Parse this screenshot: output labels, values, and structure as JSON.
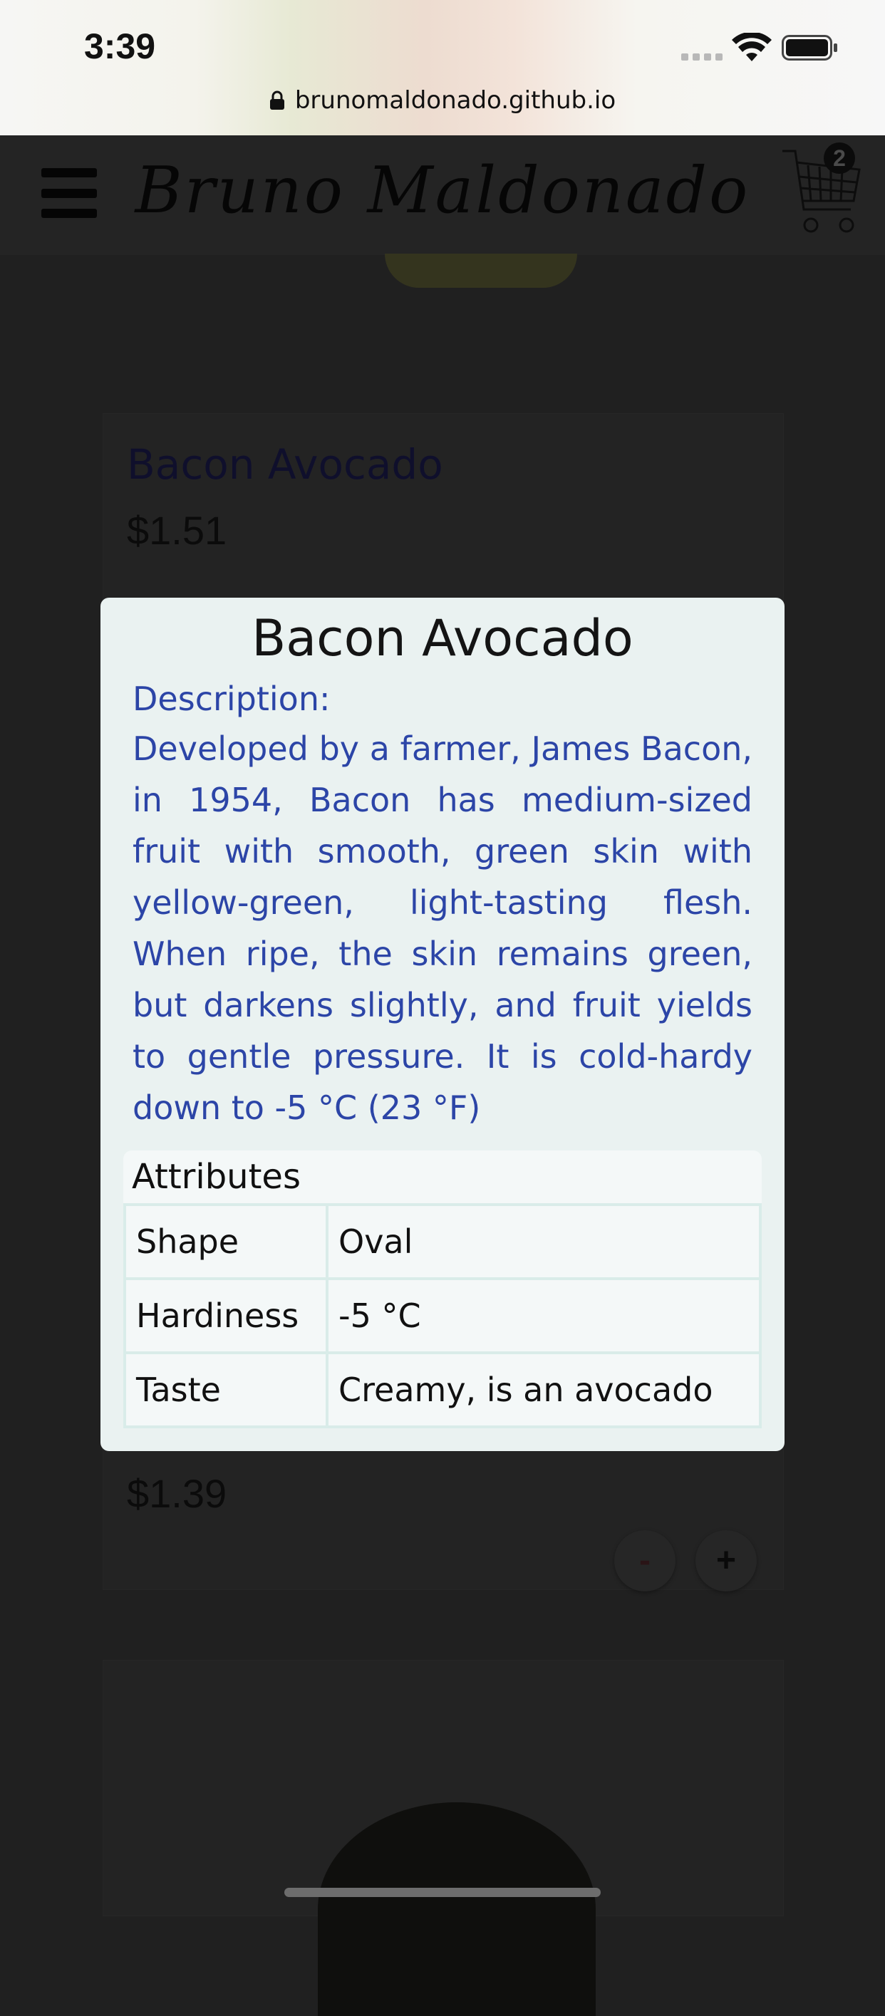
{
  "status_bar": {
    "time": "3:39",
    "url": "brunomaldonado.github.io"
  },
  "header": {
    "brand": "Bruno Maldonado",
    "cart_count": "2"
  },
  "background_products": [
    {
      "title": "Bacon Avocado",
      "price": "$1.51"
    },
    {
      "price": "$1.39",
      "minus_label": "-",
      "plus_label": "+"
    }
  ],
  "modal": {
    "title": "Bacon Avocado",
    "description_label": "Description:",
    "description": "Developed by a farmer, James Bacon, in 1954, Bacon has medium-sized fruit with smooth, green skin with yellow-green, light-tasting flesh. When ripe, the skin remains green, but darkens slightly, and fruit yields to gentle pressure. It is cold-hardy down to -5 °C (23 °F)",
    "attributes_heading": "Attributes",
    "attributes": [
      {
        "name": "Shape",
        "value": "Oval"
      },
      {
        "name": "Hardiness",
        "value": "-5 °C"
      },
      {
        "name": "Taste",
        "value": "Creamy, is an avocado"
      }
    ]
  },
  "colors": {
    "overlay": "#202020",
    "modal_background": "#eaf2f1",
    "description_text": "#2c45a7"
  }
}
